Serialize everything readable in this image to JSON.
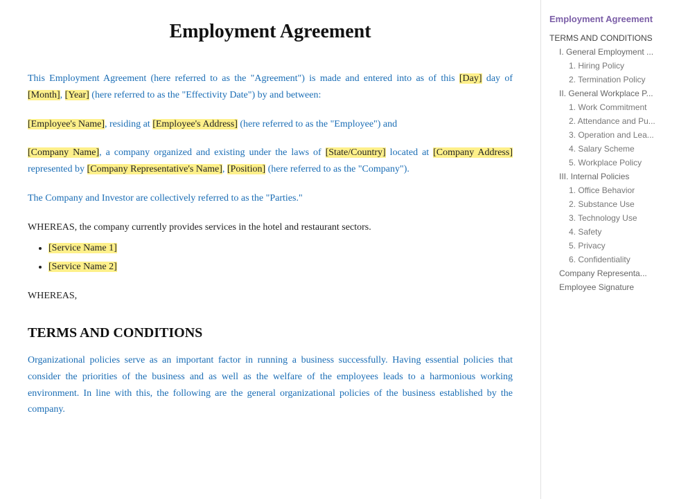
{
  "title": "Employment Agreement",
  "sidebar": {
    "title": "Employment Agreement",
    "items": [
      {
        "label": "TERMS AND CONDITIONS",
        "level": 1
      },
      {
        "label": "I. General Employment ...",
        "level": 2
      },
      {
        "label": "1. Hiring Policy",
        "level": 3
      },
      {
        "label": "2. Termination Policy",
        "level": 3
      },
      {
        "label": "II. General Workplace P...",
        "level": 2
      },
      {
        "label": "1. Work Commitment",
        "level": 3
      },
      {
        "label": "2. Attendance and Pu...",
        "level": 3
      },
      {
        "label": "3.  Operation and Lea...",
        "level": 3
      },
      {
        "label": "4. Salary Scheme",
        "level": 3
      },
      {
        "label": "5.  Workplace Policy",
        "level": 3
      },
      {
        "label": "III. Internal Policies",
        "level": 2
      },
      {
        "label": "1. Office Behavior",
        "level": 3
      },
      {
        "label": "2. Substance Use",
        "level": 3
      },
      {
        "label": "3. Technology Use",
        "level": 3
      },
      {
        "label": "4. Safety",
        "level": 3
      },
      {
        "label": "5. Privacy",
        "level": 3
      },
      {
        "label": "6. Confidentiality",
        "level": 3
      },
      {
        "label": "Company Representa...",
        "level": 2
      },
      {
        "label": "Employee Signature",
        "level": 2
      }
    ]
  },
  "intro": {
    "para1_before": "This Employment Agreement (here referred to as the \"Agreement\") is made and entered into as of this ",
    "day_placeholder": "[Day]",
    "para1_mid1": " day of ",
    "month_placeholder": "[Month]",
    "para1_mid2": ", ",
    "year_placeholder": "[Year]",
    "para1_after": " (here referred to as the \"Effectivity Date\") by and between:",
    "para2_before": "",
    "employee_name": "[Employee's Name]",
    "para2_mid": ", residing at ",
    "employee_address": "[Employee's Address]",
    "para2_after": " (here referred to as the \"Employee\") and",
    "para3_company": "[Company Name]",
    "para3_mid1": ", a company organized and existing under the laws of ",
    "state_country": "[State/Country]",
    "para3_mid2": " located at ",
    "company_address": "[Company Address]",
    "para3_mid3": " represented by ",
    "company_rep": "[Company Representative's Name]",
    "para3_mid4": ", ",
    "position": "[Position]",
    "para3_after": " (here referred to as the \"Company\").",
    "para4": "The Company and Investor are collectively referred to as the \"Parties.\"",
    "whereas1": "WHEREAS, the company currently provides services in the hotel and restaurant sectors.",
    "service1": "[Service Name 1]",
    "service2": "[Service Name 2]",
    "whereas2": "WHEREAS,"
  },
  "terms_section": {
    "heading": "TERMS AND CONDITIONS",
    "body": "Organizational policies serve as an important factor in running a business successfully. Having essential policies that consider the priorities of the business and as well as the welfare of the employees leads to a harmonious working environment. In line with this, the following are the general organizational policies of the business established by the company."
  }
}
